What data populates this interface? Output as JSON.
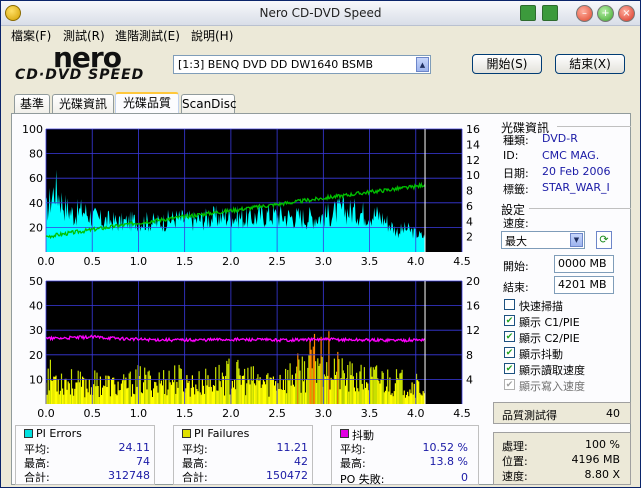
{
  "window": {
    "title": "Nero CD-DVD Speed"
  },
  "menu": [
    "檔案(F)",
    "測試(R)",
    "進階測試(E)",
    "說明(H)"
  ],
  "logo": {
    "brand": "nero",
    "product": "CD·DVD SPEED"
  },
  "drive": {
    "selected": "[1:3]  BENQ DVD DD DW1640 BSMB"
  },
  "buttons": {
    "start": "開始(S)",
    "exit": "結束(X)"
  },
  "tabs": [
    "基準",
    "光碟資訊",
    "光碟品質",
    "ScanDisc"
  ],
  "active_tab": 2,
  "disc_info": {
    "header": "光碟資訊",
    "type_label": "種類:",
    "type": "DVD-R",
    "id_label": "ID:",
    "id": "CMC MAG.",
    "date_label": "日期:",
    "date": "20 Feb 2006",
    "tag_label": "標籤:",
    "tag": "STAR_WAR_I"
  },
  "settings": {
    "header": "設定",
    "speed_label": "速度:",
    "speed": "最大",
    "start_label": "開始:",
    "start": "0000 MB",
    "end_label": "結束:",
    "end": "4201 MB",
    "checks": [
      {
        "label": "快速掃描",
        "checked": false,
        "enabled": true
      },
      {
        "label": "顯示 C1/PIE",
        "checked": true,
        "enabled": true
      },
      {
        "label": "顯示 C2/PIE",
        "checked": true,
        "enabled": true
      },
      {
        "label": "顯示抖動",
        "checked": true,
        "enabled": true
      },
      {
        "label": "顯示讀取速度",
        "checked": true,
        "enabled": true
      },
      {
        "label": "顯示寫入速度",
        "checked": true,
        "enabled": false
      }
    ]
  },
  "quality": {
    "label": "品質測試得",
    "score": "40"
  },
  "progress": {
    "status_label": "處理:",
    "status": "100 %",
    "position_label": "位置:",
    "position": "4196 MB",
    "speed_label": "速度:",
    "speed": "8.80 X"
  },
  "stats": {
    "pi_errors": {
      "title": "PI Errors",
      "color": "#00e0e0",
      "avg_label": "平均:",
      "avg": "24.11",
      "max_label": "最高:",
      "max": "74",
      "total_label": "合計:",
      "total": "312748"
    },
    "pi_failures": {
      "title": "PI Failures",
      "color": "#e0e000",
      "avg_label": "平均:",
      "avg": "11.21",
      "max_label": "最高:",
      "max": "42",
      "total_label": "合計:",
      "total": "150472"
    },
    "jitter": {
      "title": "抖動",
      "color": "#e000e0",
      "avg_label": "平均:",
      "avg": "10.52 %",
      "max_label": "最高:",
      "max": "13.8 %"
    },
    "po_failures": {
      "label": "PO 失敗:",
      "value": "0"
    }
  },
  "chart_data": [
    {
      "type": "area",
      "series": [
        {
          "name": "PI Errors",
          "color": "#00ffff",
          "x": [
            0,
            0.1,
            0.2,
            0.3,
            0.4,
            0.5,
            0.6,
            0.7,
            0.8,
            0.9,
            1.0,
            1.2,
            1.4,
            1.6,
            1.8,
            2.0,
            2.2,
            2.4,
            2.6,
            2.8,
            3.0,
            3.2,
            3.4,
            3.6,
            3.7,
            3.8,
            3.9,
            4.0,
            4.1
          ],
          "y": [
            38,
            62,
            44,
            36,
            40,
            34,
            30,
            30,
            28,
            29,
            30,
            28,
            32,
            30,
            33,
            34,
            32,
            36,
            34,
            33,
            34,
            40,
            38,
            35,
            28,
            20,
            22,
            18,
            14
          ]
        },
        {
          "name": "",
          "color": "#00c000",
          "axis": "right",
          "x": [
            0,
            0.5,
            1.0,
            1.5,
            2.0,
            2.5,
            3.0,
            3.5,
            4.0,
            4.1
          ],
          "y": [
            2.0,
            2.9,
            3.8,
            4.6,
            5.4,
            6.2,
            7.0,
            7.8,
            8.5,
            8.8
          ]
        }
      ],
      "xlim": [
        0,
        4.5
      ],
      "ylim": [
        0,
        100
      ],
      "y2lim": [
        0,
        16
      ],
      "xticks": [
        "0.0",
        "0.5",
        "1.0",
        "1.5",
        "2.0",
        "2.5",
        "3.0",
        "3.5",
        "4.0",
        "4.5"
      ],
      "yticks": [
        "20",
        "40",
        "60",
        "80",
        "100"
      ],
      "y2ticks": [
        "2",
        "4",
        "6",
        "8",
        "10",
        "12",
        "14",
        "16"
      ],
      "grid": true,
      "background": "#000000"
    },
    {
      "type": "bar",
      "series": [
        {
          "name": "PI Failures",
          "color": "#ffff00",
          "x": [
            0,
            0.2,
            0.4,
            0.6,
            0.8,
            1.0,
            1.2,
            1.4,
            1.6,
            1.8,
            2.0,
            2.2,
            2.4,
            2.6,
            2.8,
            3.0,
            3.2,
            3.4,
            3.6,
            3.8,
            4.0,
            4.1
          ],
          "y": [
            12,
            10,
            8,
            9,
            7,
            10,
            9,
            11,
            8,
            10,
            12,
            10,
            9,
            11,
            14,
            22,
            12,
            10,
            11,
            9,
            8,
            6
          ]
        },
        {
          "name": "Jitter",
          "color": "#ff00ff",
          "axis": "right",
          "x": [
            0,
            0.5,
            1.0,
            1.5,
            2.0,
            2.5,
            3.0,
            3.5,
            4.0,
            4.1
          ],
          "y": [
            10.6,
            10.9,
            10.5,
            10.4,
            10.5,
            10.4,
            10.5,
            10.4,
            10.4,
            10.5
          ]
        }
      ],
      "xlim": [
        0,
        4.5
      ],
      "ylim": [
        0,
        50
      ],
      "y2lim": [
        0,
        20
      ],
      "xticks": [
        "0.0",
        "0.5",
        "1.0",
        "1.5",
        "2.0",
        "2.5",
        "3.0",
        "3.5",
        "4.0",
        "4.5"
      ],
      "yticks": [
        "10",
        "20",
        "30",
        "40",
        "50"
      ],
      "y2ticks": [
        "4",
        "8",
        "12",
        "16",
        "20"
      ],
      "grid": true,
      "background": "#000000"
    }
  ]
}
